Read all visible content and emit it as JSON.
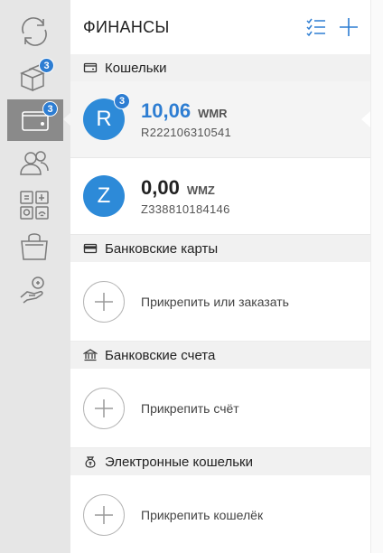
{
  "rail": {
    "items": [
      {
        "icon": "refresh-icon"
      },
      {
        "icon": "boxes-icon",
        "badge": "3"
      },
      {
        "icon": "wallet-icon",
        "badge": "3",
        "active": true
      },
      {
        "icon": "contacts-icon"
      },
      {
        "icon": "utilities-icon"
      },
      {
        "icon": "shopping-bag-icon"
      },
      {
        "icon": "hand-coin-icon"
      }
    ]
  },
  "header": {
    "title": "ФИНАНСЫ",
    "accent_color": "#2d7dd2"
  },
  "sections": {
    "wallets": {
      "label": "Кошельки"
    },
    "cards": {
      "label": "Банковские карты",
      "attach_label": "Прикрепить или заказать"
    },
    "accounts": {
      "label": "Банковские счета",
      "attach_label": "Прикрепить счёт"
    },
    "e_wallets": {
      "label": "Электронные кошельки",
      "attach_label": "Прикрепить кошелёк"
    }
  },
  "wallets": [
    {
      "letter": "R",
      "badge": "3",
      "amount": "10,06",
      "currency": "WMR",
      "id": "R222106310541",
      "selected": true
    },
    {
      "letter": "Z",
      "amount": "0,00",
      "currency": "WMZ",
      "id": "Z338810184146",
      "selected": false
    }
  ]
}
